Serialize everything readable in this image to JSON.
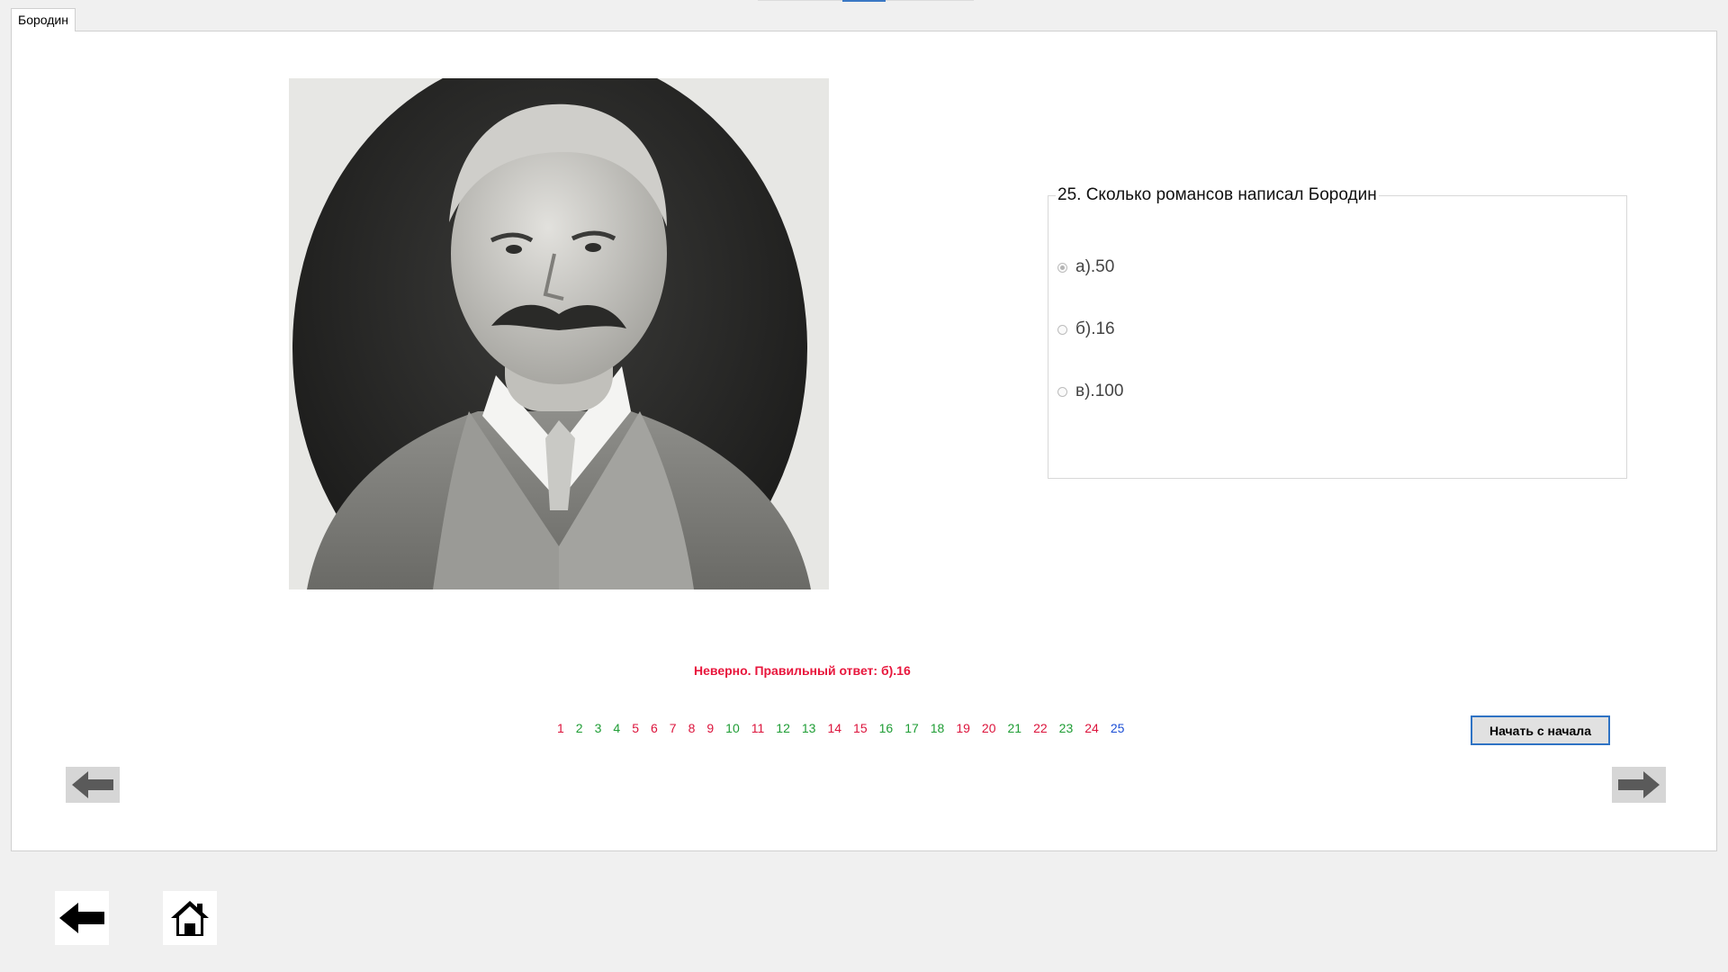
{
  "tab": {
    "label": "Бородин"
  },
  "question": {
    "title": "25. Сколько романсов написал Бородин",
    "options": [
      {
        "label": "а).50",
        "selected": true
      },
      {
        "label": "б).16",
        "selected": false
      },
      {
        "label": "в).100",
        "selected": false
      }
    ]
  },
  "feedback": {
    "text": "Неверно. Правильный ответ: б).16"
  },
  "pagination": {
    "items": [
      {
        "label": "1",
        "status": "wrong"
      },
      {
        "label": "2",
        "status": "correct"
      },
      {
        "label": "3",
        "status": "correct"
      },
      {
        "label": "4",
        "status": "correct"
      },
      {
        "label": "5",
        "status": "wrong"
      },
      {
        "label": "6",
        "status": "wrong"
      },
      {
        "label": "7",
        "status": "wrong"
      },
      {
        "label": "8",
        "status": "wrong"
      },
      {
        "label": "9",
        "status": "wrong"
      },
      {
        "label": "10",
        "status": "correct"
      },
      {
        "label": "11",
        "status": "wrong"
      },
      {
        "label": "12",
        "status": "correct"
      },
      {
        "label": "13",
        "status": "correct"
      },
      {
        "label": "14",
        "status": "wrong"
      },
      {
        "label": "15",
        "status": "wrong"
      },
      {
        "label": "16",
        "status": "correct"
      },
      {
        "label": "17",
        "status": "correct"
      },
      {
        "label": "18",
        "status": "correct"
      },
      {
        "label": "19",
        "status": "wrong"
      },
      {
        "label": "20",
        "status": "wrong"
      },
      {
        "label": "21",
        "status": "correct"
      },
      {
        "label": "22",
        "status": "wrong"
      },
      {
        "label": "23",
        "status": "correct"
      },
      {
        "label": "24",
        "status": "wrong"
      },
      {
        "label": "25",
        "status": "current"
      }
    ]
  },
  "buttons": {
    "restart_label": "Начать с начала"
  },
  "icons": {
    "prev": "arrow-left-icon",
    "next": "arrow-right-icon",
    "back": "back-arrow-icon",
    "home": "home-icon"
  },
  "colors": {
    "wrong": "#dc143c",
    "correct": "#1f9d35",
    "current": "#1c4fd6",
    "feedback": "#e8163c",
    "button_border": "#2f73c4"
  }
}
